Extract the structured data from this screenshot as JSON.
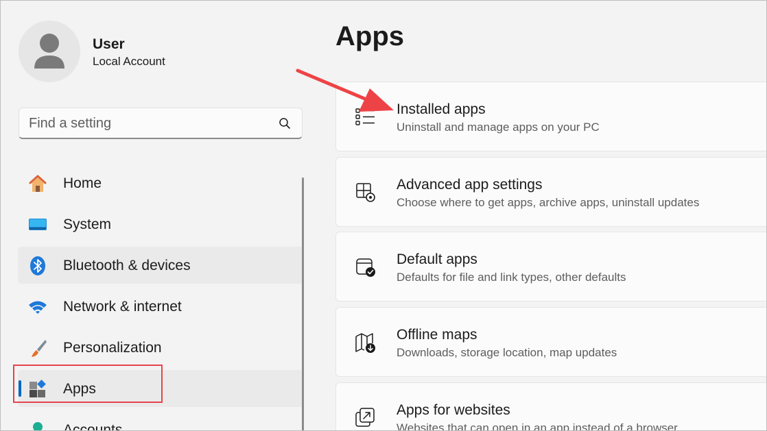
{
  "profile": {
    "name": "User",
    "account_type": "Local Account"
  },
  "search": {
    "placeholder": "Find a setting"
  },
  "nav": {
    "items": [
      {
        "label": "Home",
        "icon": "home-icon"
      },
      {
        "label": "System",
        "icon": "monitor-icon"
      },
      {
        "label": "Bluetooth & devices",
        "icon": "bluetooth-icon"
      },
      {
        "label": "Network & internet",
        "icon": "wifi-icon"
      },
      {
        "label": "Personalization",
        "icon": "paintbrush-icon"
      },
      {
        "label": "Apps",
        "icon": "apps-icon"
      },
      {
        "label": "Accounts",
        "icon": "person-icon"
      }
    ],
    "selected": "Apps"
  },
  "main": {
    "title": "Apps",
    "cards": [
      {
        "title": "Installed apps",
        "subtitle": "Uninstall and manage apps on your PC",
        "icon": "list-icon"
      },
      {
        "title": "Advanced app settings",
        "subtitle": "Choose where to get apps, archive apps, uninstall updates",
        "icon": "app-settings-icon"
      },
      {
        "title": "Default apps",
        "subtitle": "Defaults for file and link types, other defaults",
        "icon": "default-apps-icon"
      },
      {
        "title": "Offline maps",
        "subtitle": "Downloads, storage location, map updates",
        "icon": "map-icon"
      },
      {
        "title": "Apps for websites",
        "subtitle": "Websites that can open in an app instead of a browser",
        "icon": "open-in-app-icon"
      }
    ]
  },
  "colors": {
    "accent": "#0067c0",
    "annotation_red": "#e5434b",
    "background": "#f3f3f3",
    "card": "#fbfbfb"
  }
}
